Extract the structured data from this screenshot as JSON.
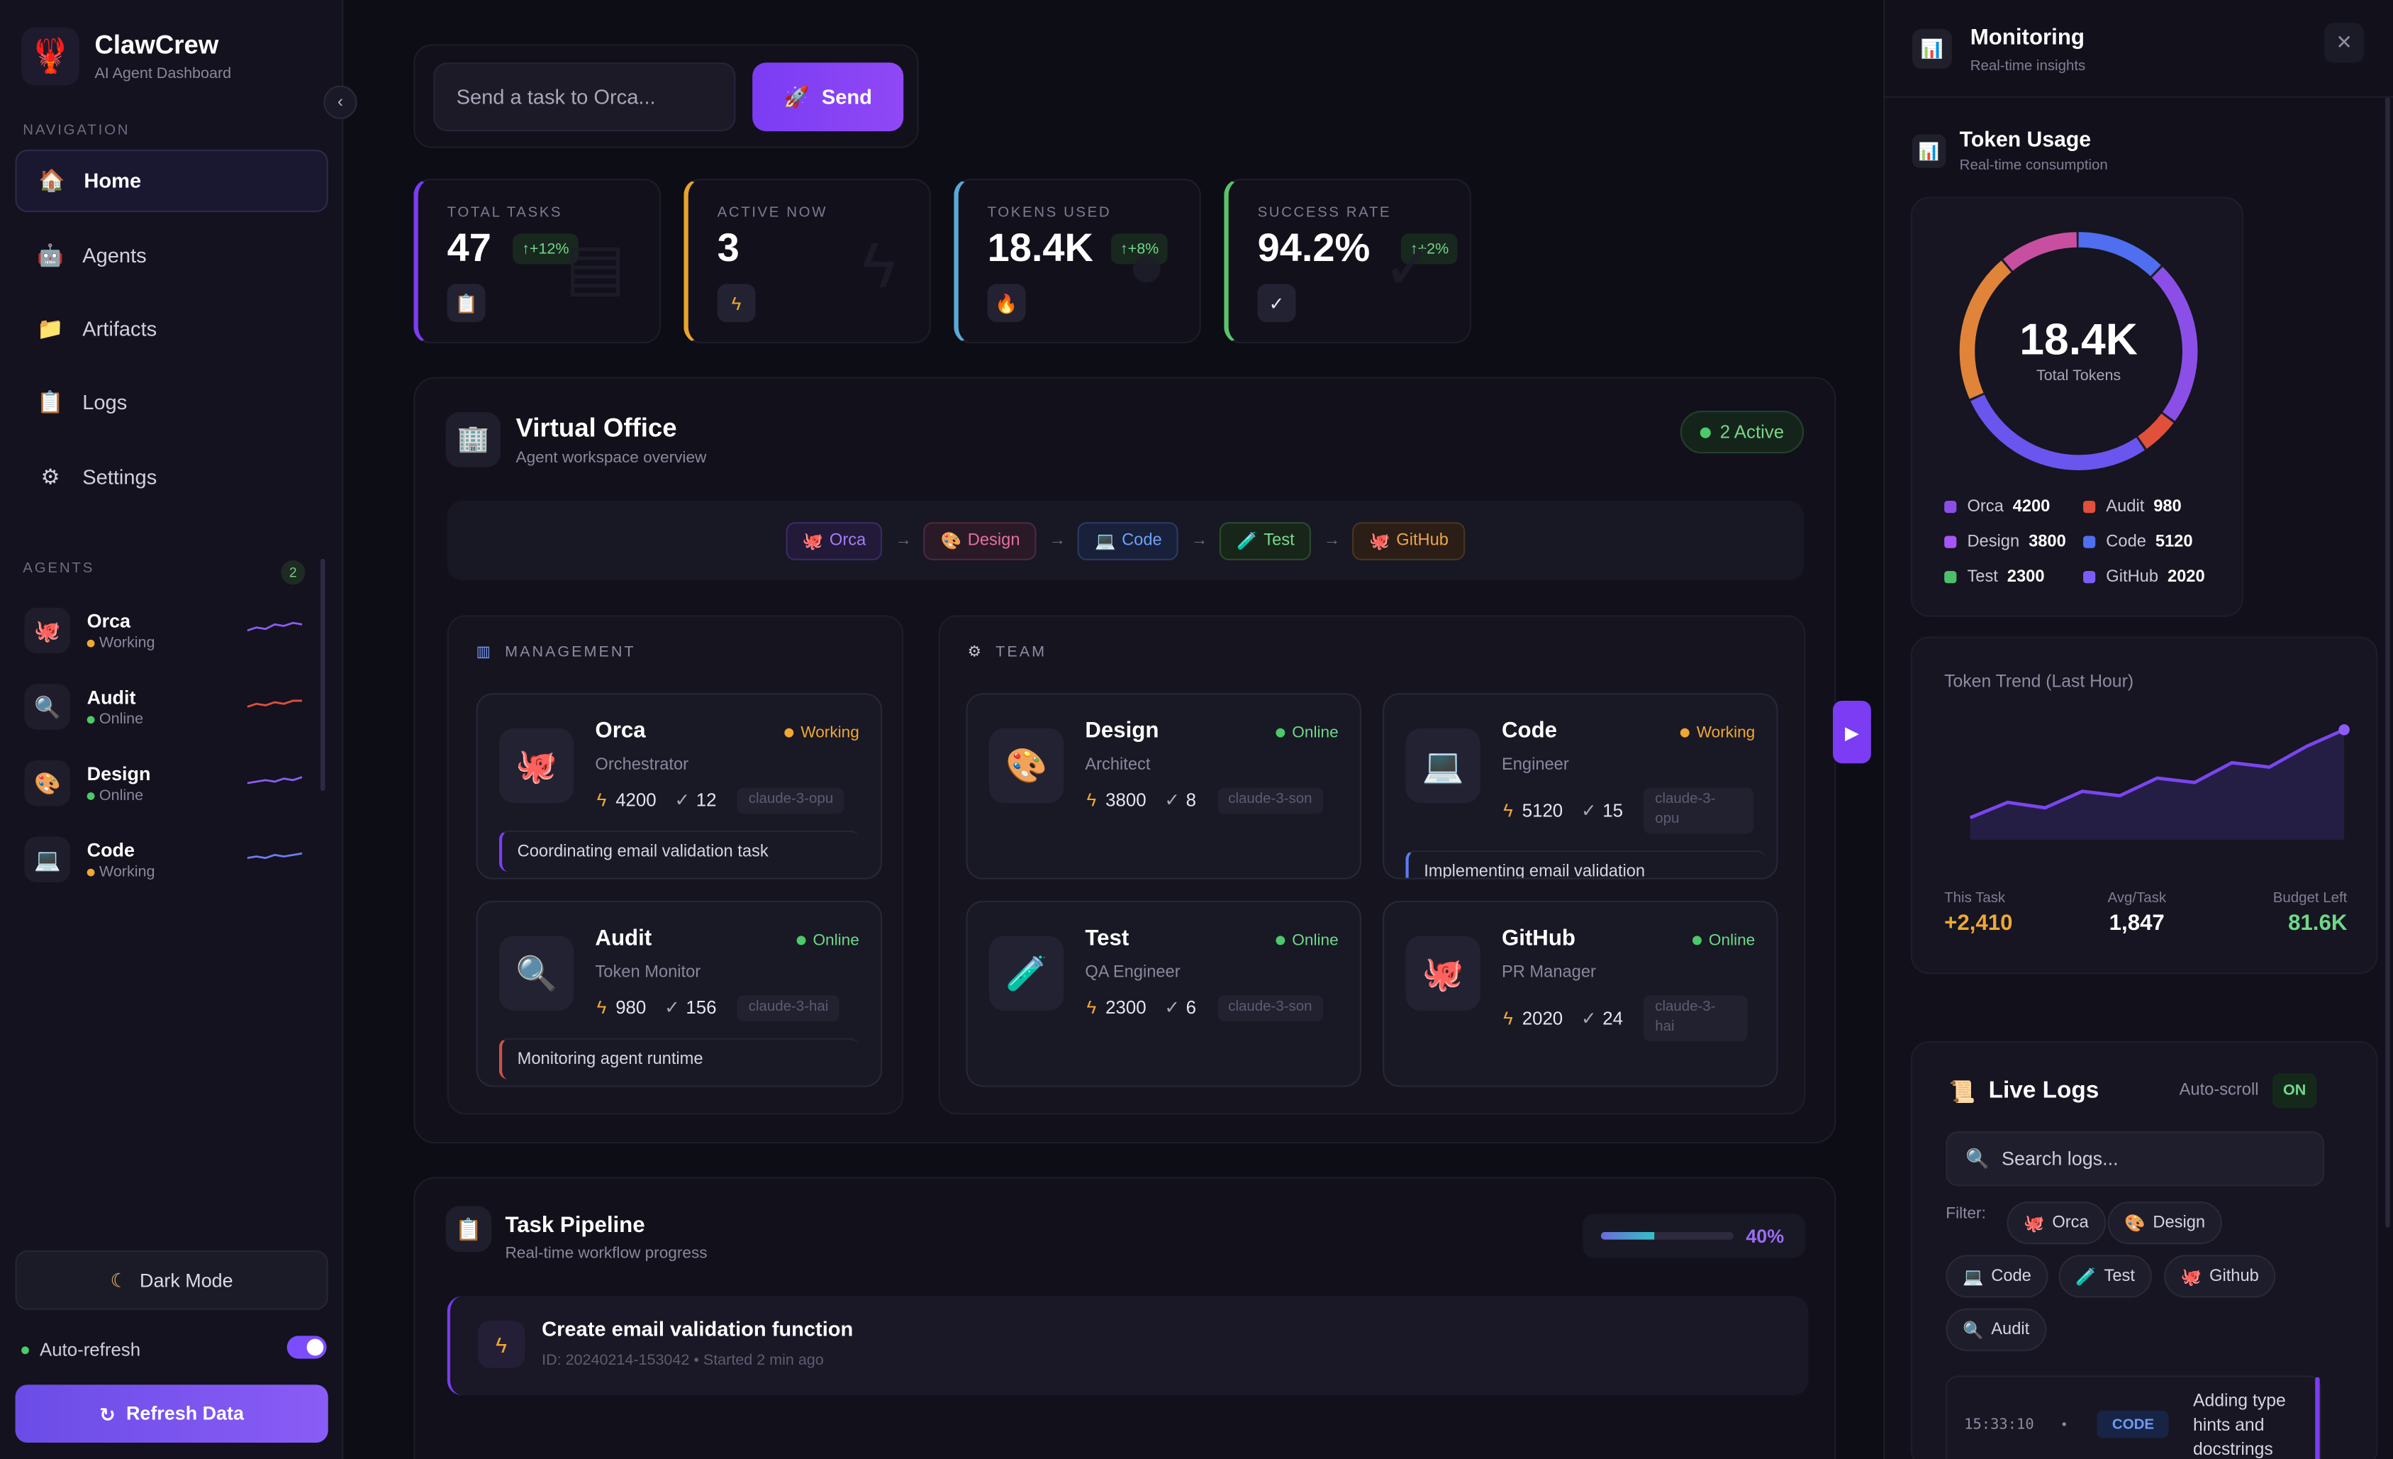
{
  "brand": {
    "name": "ClawCrew",
    "subtitle": "AI Agent Dashboard",
    "logo_icon": "lobster-icon"
  },
  "sidebar": {
    "navigation_label": "NAVIGATION",
    "nav_items": [
      {
        "label": "Home",
        "icon": "home-icon",
        "active": true
      },
      {
        "label": "Agents",
        "icon": "robot-icon"
      },
      {
        "label": "Artifacts",
        "icon": "folder-icon"
      },
      {
        "label": "Logs",
        "icon": "clipboard-icon"
      },
      {
        "label": "Settings",
        "icon": "gear-icon"
      }
    ],
    "agents_label": "AGENTS",
    "agents_count": "2",
    "agents": [
      {
        "name": "Orca",
        "status": "Working",
        "icon": "octopus-icon"
      },
      {
        "name": "Audit",
        "status": "Online",
        "icon": "magnifier-icon"
      },
      {
        "name": "Design",
        "status": "Online",
        "icon": "palette-icon"
      },
      {
        "name": "Code",
        "status": "Working",
        "icon": "laptop-icon"
      }
    ],
    "dark_mode_label": "Dark Mode",
    "auto_refresh_label": "Auto-refresh",
    "auto_refresh_on": true,
    "refresh_button": "Refresh Data"
  },
  "task": {
    "placeholder": "Send a task to Orca...",
    "send_label": "Send"
  },
  "stats": [
    {
      "label": "TOTAL TASKS",
      "value": "47",
      "change": "↑+12%",
      "color": "#7b3cf3"
    },
    {
      "label": "ACTIVE NOW",
      "value": "3",
      "change": "",
      "color": "#e8a42c"
    },
    {
      "label": "TOKENS USED",
      "value": "18.4K",
      "change": "↑+8%",
      "color": "#5aa9d8"
    },
    {
      "label": "SUCCESS RATE",
      "value": "94.2%",
      "change": "↑+2%",
      "color": "#58c46a"
    }
  ],
  "office": {
    "title": "Virtual Office",
    "subtitle": "Agent workspace overview",
    "active": "2 Active",
    "flow": [
      "Orca",
      "Design",
      "Code",
      "Test",
      "GitHub"
    ],
    "management_label": "MANAGEMENT",
    "team_label": "TEAM",
    "cards": [
      {
        "name": "Orca",
        "role": "Orchestrator",
        "status": "Working",
        "tokens": "4200",
        "tasks": "12",
        "model": "claude-3-opu",
        "note": "Coordinating email validation task",
        "icon": "octopus-icon"
      },
      {
        "name": "Audit",
        "role": "Token Monitor",
        "status": "Online",
        "tokens": "980",
        "tasks": "156",
        "model": "claude-3-hai",
        "note": "Monitoring agent runtime",
        "icon": "magnifier-icon"
      },
      {
        "name": "Design",
        "role": "Architect",
        "status": "Online",
        "tokens": "3800",
        "tasks": "8",
        "model": "claude-3-son",
        "note": "",
        "icon": "palette-icon"
      },
      {
        "name": "Code",
        "role": "Engineer",
        "status": "Working",
        "tokens": "5120",
        "tasks": "15",
        "model": "claude-3-\nopu",
        "note": "Implementing email validation",
        "icon": "laptop-icon"
      },
      {
        "name": "Test",
        "role": "QA Engineer",
        "status": "Online",
        "tokens": "2300",
        "tasks": "6",
        "model": "claude-3-son",
        "note": "",
        "icon": "test-tube-icon"
      },
      {
        "name": "GitHub",
        "role": "PR Manager",
        "status": "Online",
        "tokens": "2020",
        "tasks": "24",
        "model": "claude-3-\nhai",
        "note": "",
        "icon": "octocat-icon"
      }
    ]
  },
  "pipeline": {
    "title": "Task Pipeline",
    "subtitle": "Real-time workflow progress",
    "progress": 0.4,
    "progress_label": "40%",
    "item": {
      "title": "Create email validation function",
      "meta": "ID: 20240214-153042  •  Started 2 min ago"
    }
  },
  "monitoring": {
    "title": "Monitoring",
    "subtitle": "Real-time insights",
    "token_usage": {
      "title": "Token Usage",
      "subtitle": "Real-time consumption",
      "total": "18.4K",
      "total_label": "Total Tokens",
      "legend": [
        {
          "name": "Orca",
          "value": "4200",
          "color": "#8b4fe8"
        },
        {
          "name": "Audit",
          "value": "980",
          "color": "#e0503a"
        },
        {
          "name": "Design",
          "value": "3800",
          "color": "#a855f7"
        },
        {
          "name": "Code",
          "value": "5120",
          "color": "#4f6ff0"
        },
        {
          "name": "Test",
          "value": "2300",
          "color": "#4cbf6a"
        },
        {
          "name": "GitHub",
          "value": "2020",
          "color": "#7c5cf6"
        }
      ]
    },
    "trend": {
      "title": "Token Trend (Last Hour)",
      "points": [
        0.2,
        0.34,
        0.29,
        0.44,
        0.4,
        0.56,
        0.52,
        0.7,
        0.66,
        0.85,
        1.0
      ],
      "stats": [
        {
          "label": "This Task",
          "value": "+2,410",
          "color": "#f0a830"
        },
        {
          "label": "Avg/Task",
          "value": "1,847",
          "color": "#ffffff"
        },
        {
          "label": "Budget Left",
          "value": "81.6K",
          "color": "#6fd889"
        }
      ]
    },
    "logs": {
      "title": "Live Logs",
      "autoscroll_label": "Auto-scroll",
      "autoscroll_state": "ON",
      "search_placeholder": "Search logs...",
      "filter_label": "Filter:",
      "filters": [
        "Orca",
        "Design",
        "Code",
        "Test",
        "Github",
        "Audit"
      ],
      "entry": {
        "time": "15:33:10",
        "tag": "CODE",
        "message": "Adding type hints and docstrings"
      }
    }
  }
}
